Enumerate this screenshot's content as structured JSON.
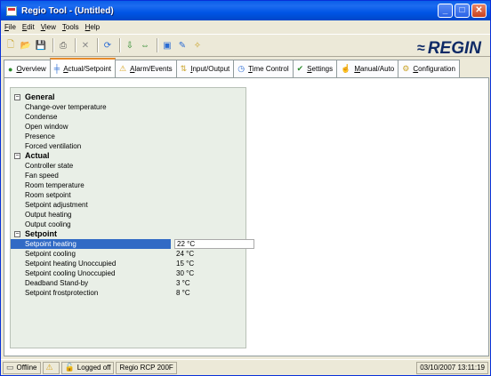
{
  "window": {
    "title": "Regio Tool - (Untitled)",
    "controls": [
      "minimize-icon",
      "maximize-icon",
      "close-icon"
    ]
  },
  "menu": [
    "File",
    "Edit",
    "View",
    "Tools",
    "Help"
  ],
  "toolbar": {
    "icons": [
      "new-icon",
      "open-icon",
      "save-icon",
      "print-icon",
      "delete-icon",
      "refresh-icon",
      "download-icon",
      "transfer-icon",
      "dialog-icon",
      "edit-icon",
      "wizard-icon"
    ],
    "logo": "REGIN"
  },
  "tabs": [
    {
      "label": "Overview",
      "icon": "overview-icon",
      "active": false
    },
    {
      "label": "Actual/Setpoint",
      "icon": "setpoint-icon",
      "active": true
    },
    {
      "label": "Alarm/Events",
      "icon": "alarm-icon",
      "active": false
    },
    {
      "label": "Input/Output",
      "icon": "io-icon",
      "active": false
    },
    {
      "label": "Time Control",
      "icon": "time-icon",
      "active": false
    },
    {
      "label": "Settings",
      "icon": "settings-icon",
      "active": false
    },
    {
      "label": "Manual/Auto",
      "icon": "manual-icon",
      "active": false
    },
    {
      "label": "Configuration",
      "icon": "config-icon",
      "active": false
    }
  ],
  "tree": {
    "groups": [
      {
        "label": "General",
        "items": [
          {
            "label": "Change-over temperature",
            "value": ""
          },
          {
            "label": "Condense",
            "value": ""
          },
          {
            "label": "Open window",
            "value": ""
          },
          {
            "label": "Presence",
            "value": ""
          },
          {
            "label": "Forced ventilation",
            "value": ""
          }
        ]
      },
      {
        "label": "Actual",
        "items": [
          {
            "label": "Controller state",
            "value": ""
          },
          {
            "label": "Fan speed",
            "value": ""
          },
          {
            "label": "Room temperature",
            "value": ""
          },
          {
            "label": "Room setpoint",
            "value": ""
          },
          {
            "label": "Setpoint adjustment",
            "value": ""
          },
          {
            "label": "Output heating",
            "value": ""
          },
          {
            "label": "Output cooling",
            "value": ""
          }
        ]
      },
      {
        "label": "Setpoint",
        "items": [
          {
            "label": "Setpoint heating",
            "value": "22 °C",
            "selected": true
          },
          {
            "label": "Setpoint cooling",
            "value": "24 °C"
          },
          {
            "label": "Setpoint heating Unoccupied",
            "value": "15 °C"
          },
          {
            "label": "Setpoint cooling Unoccupied",
            "value": "30 °C"
          },
          {
            "label": "Deadband Stand-by",
            "value": "3 °C"
          },
          {
            "label": "Setpoint frostprotection",
            "value": "8 °C"
          }
        ]
      }
    ]
  },
  "status": {
    "connection": "Offline",
    "login": "Logged off",
    "device": "Regio RCP 200F",
    "datetime": "03/10/2007 13:11:19"
  }
}
